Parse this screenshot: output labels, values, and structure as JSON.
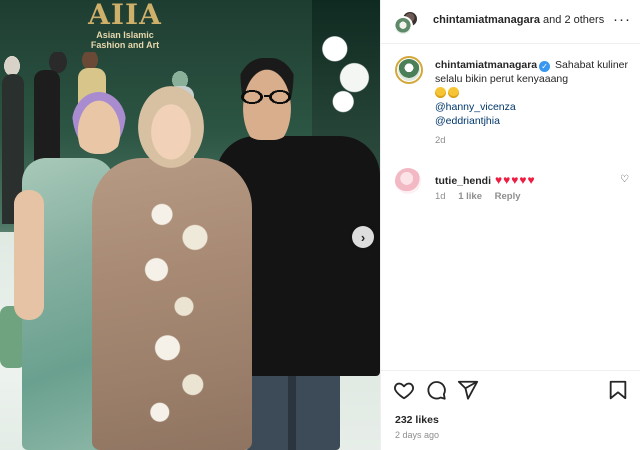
{
  "logo": {
    "mark": "AIIA",
    "line1": "Asian Islamic",
    "line2": "Fashion and Art"
  },
  "photo": {
    "next_icon": "chevron-right-icon",
    "next_glyph": "›"
  },
  "header": {
    "username": "chintamiatmanagara",
    "others": " and 2 others",
    "more_icon": "ellipsis-icon",
    "more_glyph": "···"
  },
  "caption": {
    "username": "chintamiatmanagara",
    "verified_glyph": "✓",
    "text": "Sahabat kuliner selalu bikin perut kenyaaang",
    "emojis": [
      "grinning-emoji",
      "grinning-emoji"
    ],
    "mentions": [
      "@hanny_vicenza",
      "@eddriantjhia"
    ],
    "time": "2d"
  },
  "comment": {
    "username": "tutie_hendi",
    "hearts": "♥♥♥♥♥",
    "time": "1d",
    "likes": "1 like",
    "reply": "Reply",
    "like_glyph": "♡"
  },
  "actions": {
    "icons": [
      "heart-icon",
      "comment-icon",
      "share-icon",
      "save-icon"
    ]
  },
  "footer": {
    "likes": "232 likes",
    "time": "2 days ago"
  },
  "colors": {
    "link": "#00376b",
    "verified": "#3897f0",
    "heart": "#ed1c40",
    "muted": "#8e8e8e"
  }
}
